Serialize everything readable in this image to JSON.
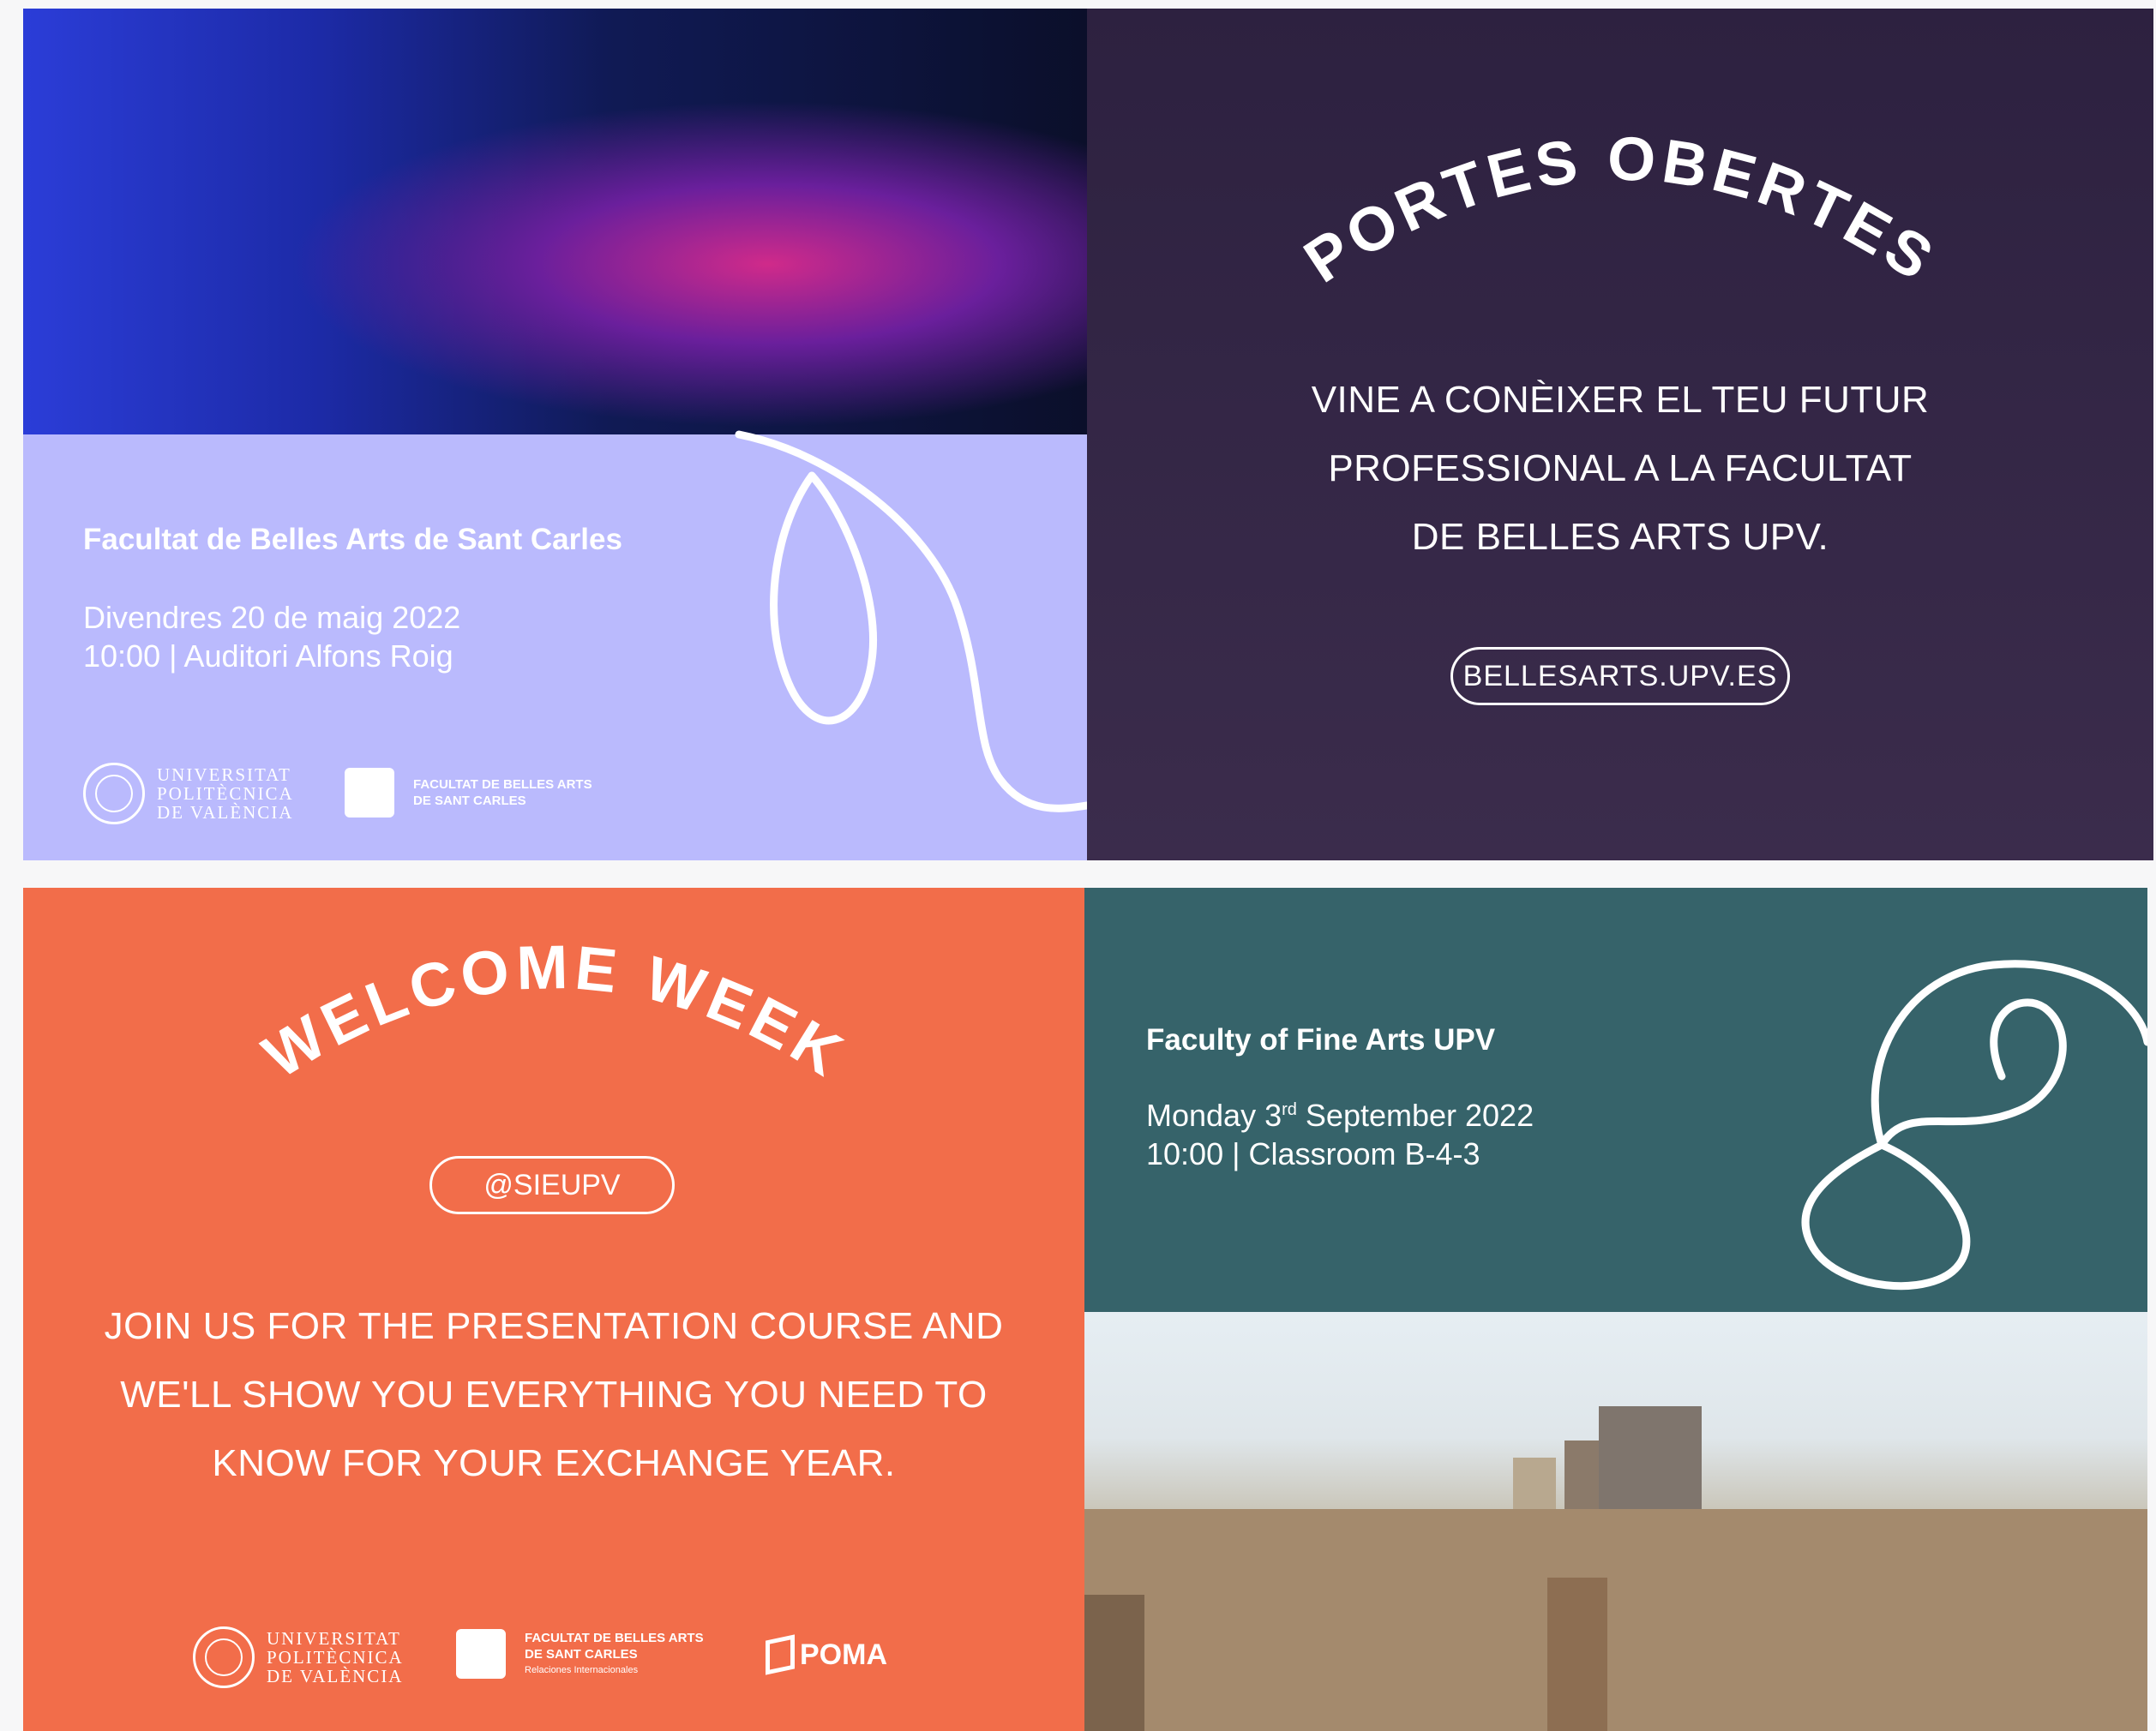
{
  "panel_top_left": {
    "faculty": "Facultat de Belles Arts de Sant Carles",
    "date": "Divendres 20 de maig 2022",
    "time_place": "10:00 |  Auditori Alfons Roig",
    "upv_logo": [
      "UNIVERSITAT",
      "POLITÈCNICA",
      "DE VALÈNCIA"
    ],
    "fba_logo": [
      "FACULTAT DE BELLES ARTS",
      "DE SANT CARLES"
    ],
    "colors": {
      "lavender": "#babafd"
    }
  },
  "panel_top_right": {
    "arc_title": "PORTES OBERTES",
    "body": [
      "VINE A CONÈIXER EL TEU FUTUR",
      "PROFESSIONAL A LA FACULTAT",
      "DE BELLES ARTS UPV."
    ],
    "website": "BELLESARTS.UPV.ES",
    "colors": {
      "background": "#2d2140"
    }
  },
  "panel_bottom_left": {
    "arc_title": "WELCOME WEEK",
    "handle": "@SIEUPV",
    "body": [
      "JOIN US FOR THE PRESENTATION COURSE AND",
      "WE'LL SHOW YOU EVERYTHING YOU NEED TO",
      "KNOW FOR YOUR EXCHANGE YEAR."
    ],
    "upv_logo": [
      "UNIVERSITAT",
      "POLITÈCNICA",
      "DE VALÈNCIA"
    ],
    "fba_logo": [
      "FACULTAT DE BELLES ARTS",
      "DE SANT CARLES",
      "Relaciones Internacionales"
    ],
    "poma": "POMA",
    "colors": {
      "background": "#f26d4a"
    }
  },
  "panel_bottom_right": {
    "faculty": "Faculty of Fine Arts UPV",
    "date_prefix": "Monday 3",
    "date_sup": "rd",
    "date_suffix": " September 2022",
    "time_place": "10:00 |  Classroom B-4-3",
    "colors": {
      "teal": "#36636a"
    }
  }
}
